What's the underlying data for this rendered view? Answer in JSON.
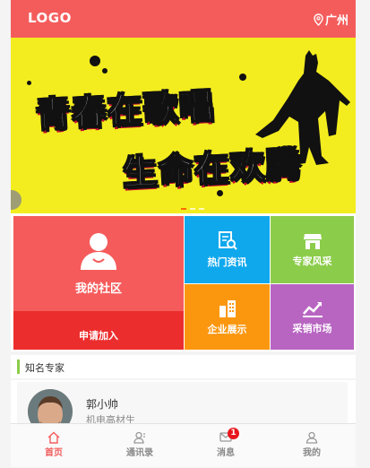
{
  "header": {
    "logo": "LOGO",
    "location": "广州"
  },
  "banner": {
    "line1": "青春在歌唱",
    "line2": "生命在欢腾",
    "active_dot": 0,
    "dot_count": 3
  },
  "tiles": {
    "community": "我的社区",
    "join": "申请加入",
    "news": "热门资讯",
    "experts": "专家风采",
    "enterprise": "企业展示",
    "purchase": "采销市场"
  },
  "experts_section": {
    "title": "知名专家",
    "items": [
      {
        "name": "郭小帅",
        "title": "机电高材生"
      }
    ]
  },
  "bottom_nav": {
    "items": [
      {
        "label": "首页",
        "icon": "home-icon",
        "active": true
      },
      {
        "label": "通讯录",
        "icon": "contacts-icon"
      },
      {
        "label": "消息",
        "icon": "message-icon",
        "badge": "1"
      },
      {
        "label": "我的",
        "icon": "user-icon"
      }
    ]
  },
  "colors": {
    "header": "#f45c5c",
    "banner": "#f3ed1f",
    "community": "#f55b5b",
    "join": "#ec2d2d",
    "news": "#10a8ed",
    "experts": "#8ccc4b",
    "enterprise": "#fb970f",
    "purchase": "#b865c2"
  }
}
